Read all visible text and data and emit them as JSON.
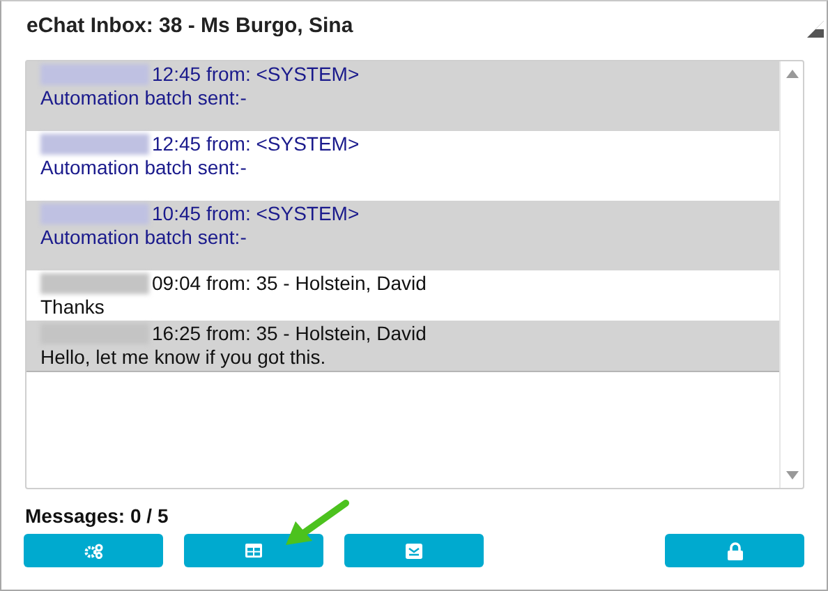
{
  "window": {
    "title": "eChat Inbox: 38 - Ms Burgo, Sina"
  },
  "messages": [
    {
      "kind": "system",
      "time": "12:45",
      "from": "from: <SYSTEM>",
      "body": "Automation batch sent:-"
    },
    {
      "kind": "system",
      "time": "12:45",
      "from": "from: <SYSTEM>",
      "body": "Automation batch sent:-"
    },
    {
      "kind": "system",
      "time": "10:45",
      "from": "from: <SYSTEM>",
      "body": "Automation batch sent:-"
    },
    {
      "kind": "user",
      "time": "09:04",
      "from": "from: 35 - Holstein, David",
      "body": "Thanks"
    },
    {
      "kind": "user",
      "time": "16:25",
      "from": "from: 35 - Holstein, David",
      "body": "Hello, let me know if you got this."
    }
  ],
  "counter": "Messages: 0 / 5",
  "buttons": [
    {
      "kind": "settings"
    },
    {
      "kind": "table"
    },
    {
      "kind": "mail"
    },
    {
      "kind": "lock"
    }
  ]
}
